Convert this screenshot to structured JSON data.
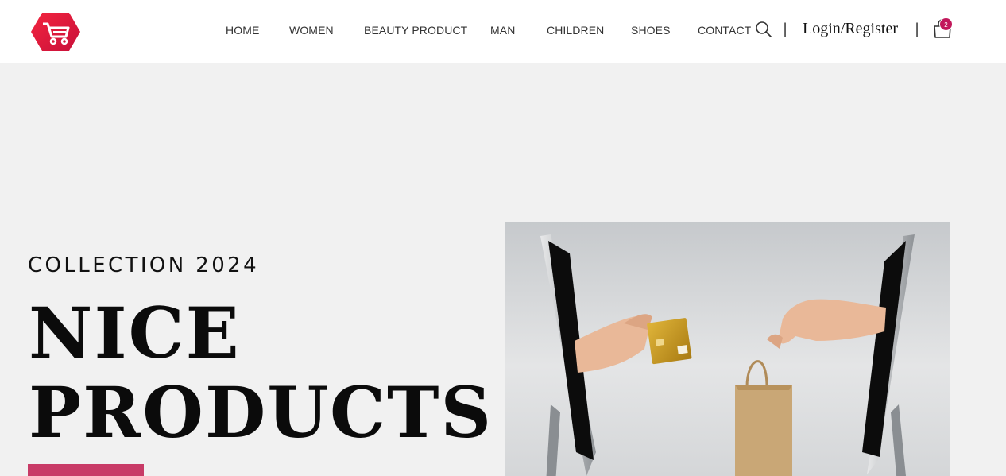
{
  "header": {
    "logo_name": "shopping-cart-logo",
    "nav": [
      "HOME",
      "WOMEN",
      "BEAUTY PRODUCT",
      "MAN",
      "CHILDREN",
      "SHOES",
      "CONTACT"
    ],
    "separator": "|",
    "login_label": "Login/Register",
    "cart_count": "2"
  },
  "hero": {
    "subtitle": "COLLECTION 2024",
    "title_line1": "NICE",
    "title_line2": "PRODUCTS"
  },
  "colors": {
    "accent": "#c83b67",
    "logo_red": "#e8173c",
    "background": "#f1f1f1"
  }
}
